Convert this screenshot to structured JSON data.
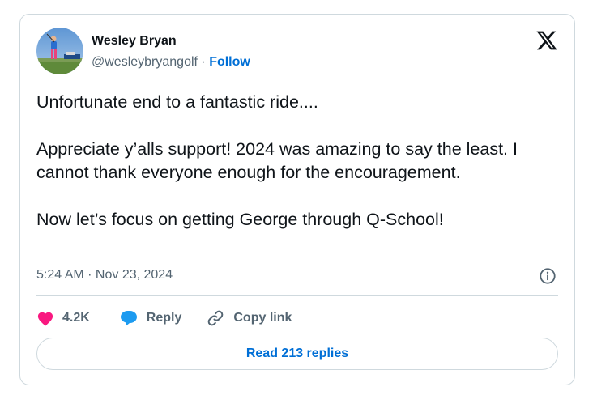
{
  "author": {
    "name": "Wesley Bryan",
    "handle": "@wesleybryangolf",
    "separator": " · ",
    "follow_label": "Follow",
    "avatar_icon": "golfer-avatar"
  },
  "platform_icon": "x-logo-icon",
  "tweet": {
    "paragraphs": [
      "Unfortunate end to a fantastic ride....",
      "Appreciate y’alls support! 2024 was amazing to say the least. I cannot thank everyone enough for the encouragement.",
      "Now let’s focus on getting George through Q-School!"
    ],
    "timestamp": "5:24 AM · Nov 23, 2024"
  },
  "actions": {
    "like_count": "4.2K",
    "reply_label": "Reply",
    "copy_link_label": "Copy link"
  },
  "read_replies_label": "Read 213 replies",
  "colors": {
    "link_blue": "#006fd6",
    "heart_pink": "#f91880",
    "reply_blue": "#1d9bf0",
    "muted_gray": "#536471",
    "border": "#cfd9de"
  }
}
